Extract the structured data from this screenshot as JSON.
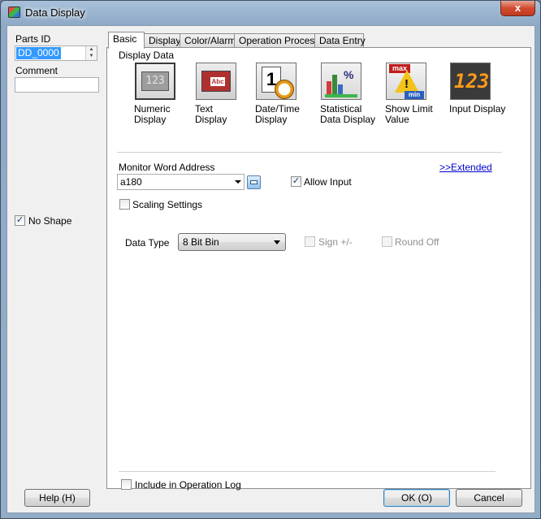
{
  "window": {
    "title": "Data Display",
    "close_glyph": "x"
  },
  "left": {
    "parts_id_label": "Parts ID",
    "parts_id_value": "DD_0000",
    "comment_label": "Comment",
    "comment_value": "",
    "no_shape_label": "No Shape",
    "no_shape_checked": true
  },
  "tabs": [
    {
      "label": "Basic",
      "active": true
    },
    {
      "label": "Display",
      "active": false
    },
    {
      "label": "Color/Alarm",
      "active": false
    },
    {
      "label": "Operation Process",
      "active": false
    },
    {
      "label": "Data Entry",
      "active": false
    }
  ],
  "basic": {
    "display_data_label": "Display Data",
    "display_types": [
      {
        "line1": "Numeric",
        "line2": "Display",
        "icon": "numeric-display-icon",
        "selected": true
      },
      {
        "line1": "Text",
        "line2": "Display",
        "icon": "text-display-icon",
        "selected": false
      },
      {
        "line1": "Date/Time",
        "line2": "Display",
        "icon": "date-time-display-icon",
        "selected": false
      },
      {
        "line1": "Statistical",
        "line2": "Data Display",
        "icon": "statistical-data-display-icon",
        "selected": false
      },
      {
        "line1": "Show Limit",
        "line2": "Value",
        "icon": "show-limit-value-icon",
        "selected": false
      },
      {
        "line1": "Input Display",
        "line2": "",
        "icon": "input-display-icon",
        "selected": false
      }
    ],
    "monitor_word_address_label": "Monitor Word Address",
    "monitor_word_address_value": "a180",
    "extended_link": ">>Extended",
    "allow_input_label": "Allow Input",
    "allow_input_checked": true,
    "scaling_settings_label": "Scaling Settings",
    "scaling_settings_checked": false,
    "data_type_label": "Data Type",
    "data_type_value": "8 Bit Bin",
    "sign_label": "Sign +/-",
    "round_off_label": "Round Off",
    "include_log_label": "Include in Operation Log",
    "include_log_checked": false
  },
  "footer": {
    "help_label": "Help (H)",
    "ok_label": "OK (O)",
    "cancel_label": "Cancel"
  }
}
